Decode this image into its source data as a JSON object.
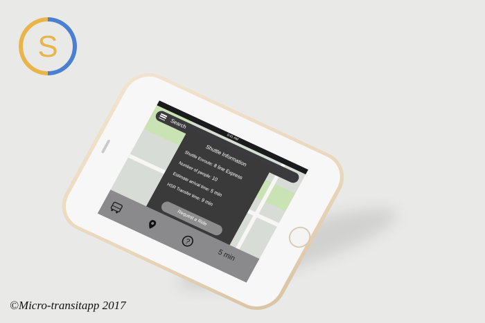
{
  "logo": {
    "letter": "S",
    "colors": {
      "blue": "#4a7fd1",
      "gold": "#e9b44a"
    }
  },
  "caption": "©Micro-transitapp 2017",
  "app": {
    "status_time": "9:41 AM",
    "search": {
      "label": "Search"
    },
    "panel": {
      "title": "Shuttle Information",
      "shuttle_label": "Shuttle Enroute:",
      "shuttle_value": "8 line Express",
      "people_label": "Number of people:",
      "people_value": "10",
      "arrival_label": "Estimate arrival time:",
      "arrival_value": "5 min",
      "transfer_label": "HSR Transfer time:",
      "transfer_value": "9 min",
      "request_button": "Request a Ride"
    },
    "eta": "5 min",
    "tabs": [
      {
        "icon": "bus-icon"
      },
      {
        "icon": "location-pin-icon"
      },
      {
        "icon": "help-icon"
      }
    ]
  },
  "colors": {
    "background": "#e9e9e8",
    "panel": "#3a3a3b",
    "phone_gold": "#e9d7bb"
  }
}
